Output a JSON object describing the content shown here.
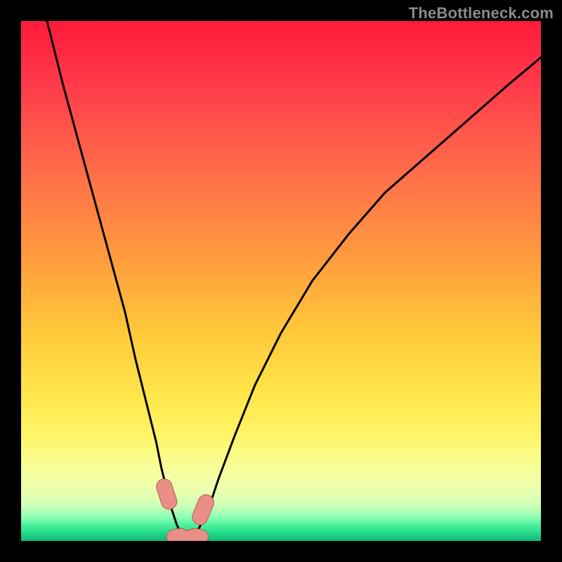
{
  "watermark": "TheBottleneck.com",
  "colors": {
    "frame": "#000000",
    "watermark": "#8a8a8a",
    "curve": "#000000",
    "marker_fill": "#e98f87",
    "marker_stroke": "#b95a4e",
    "gradient_stops": [
      {
        "offset": 0.0,
        "color": "#ff1a3a"
      },
      {
        "offset": 0.12,
        "color": "#ff3a4a"
      },
      {
        "offset": 0.28,
        "color": "#ff6a4a"
      },
      {
        "offset": 0.45,
        "color": "#ff9a3e"
      },
      {
        "offset": 0.6,
        "color": "#ffc93a"
      },
      {
        "offset": 0.72,
        "color": "#ffe64a"
      },
      {
        "offset": 0.8,
        "color": "#fff56a"
      },
      {
        "offset": 0.86,
        "color": "#f8ff9a"
      },
      {
        "offset": 0.905,
        "color": "#eaffb0"
      },
      {
        "offset": 0.935,
        "color": "#c8ffb8"
      },
      {
        "offset": 0.955,
        "color": "#88ffb4"
      },
      {
        "offset": 0.97,
        "color": "#4af09c"
      },
      {
        "offset": 0.985,
        "color": "#23d88a"
      },
      {
        "offset": 1.0,
        "color": "#0fb874"
      }
    ]
  },
  "chart_data": {
    "type": "line",
    "title": "",
    "xlabel": "",
    "ylabel": "",
    "xlim": [
      0,
      100
    ],
    "ylim": [
      0,
      100
    ],
    "series": [
      {
        "name": "bottleneck-curve",
        "x": [
          5,
          8,
          11,
          14,
          17,
          20,
          22,
          24,
          26,
          27,
          28,
          29,
          30,
          31,
          32,
          33,
          34,
          36,
          38,
          41,
          45,
          50,
          56,
          63,
          70,
          78,
          86,
          94,
          100
        ],
        "y": [
          100,
          88,
          77,
          66,
          55,
          44,
          35,
          27,
          19,
          14,
          10,
          6,
          3,
          1,
          0.5,
          0.8,
          2,
          6,
          12,
          20,
          30,
          40,
          50,
          59,
          67,
          74,
          81,
          88,
          93
        ]
      }
    ],
    "markers": [
      {
        "name": "left-anchor",
        "shape": "pill",
        "x": 28.0,
        "y": 9.0,
        "w": 3.0,
        "h": 6.0,
        "angle": -18
      },
      {
        "name": "right-anchor",
        "shape": "pill",
        "x": 35.0,
        "y": 6.0,
        "w": 3.0,
        "h": 6.0,
        "angle": 22
      },
      {
        "name": "bottom-seat",
        "shape": "peanut",
        "x": 32.0,
        "y": 0.8,
        "w": 8.0,
        "h": 3.2,
        "angle": 0
      }
    ]
  }
}
